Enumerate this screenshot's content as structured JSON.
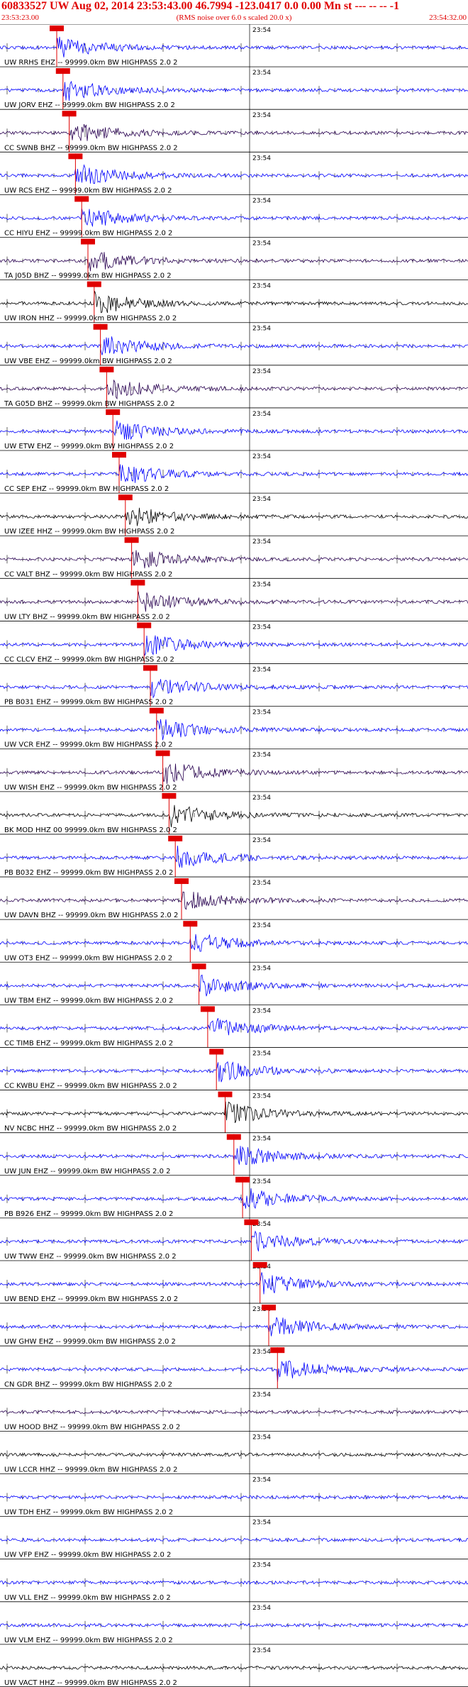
{
  "header": {
    "title": "60833527 UW Aug 02, 2014 23:53:43.00   46.7994 -123.0417   0.0 0.00 Mn st --- -- --   -1",
    "start_time": "23:53:23.00",
    "note": "(RMS noise over 6.0 s scaled 20.0 x)",
    "end_time": "23:54:32.00"
  },
  "colors": {
    "header_text": "#e00000",
    "pick": "#e00000",
    "trace_blue": "#0000ff",
    "trace_dark": "#280050",
    "trace_black": "#000000"
  },
  "chart_data": {
    "type": "line",
    "title": "60833527 UW Aug 02, 2014 23:53:43.00   46.7994 -123.0417   0.0 0.00 Mn st --- -- --   -1",
    "x_axis": {
      "start": "23:53:23.00",
      "end": "23:54:32.00",
      "minute_label": "23:54",
      "grid": true
    },
    "traces": [
      {
        "label": "UW RRHS EHZ -- 99999.0km BW  HIGHPASS  2.0  2",
        "pick": true,
        "color": "blue"
      },
      {
        "label": "UW JORV EHZ -- 99999.0km BW  HIGHPASS  2.0  2",
        "pick": true,
        "color": "blue"
      },
      {
        "label": "CC SWNB BHZ -- 99999.0km BW  HIGHPASS  2.0  2",
        "pick": true,
        "color": "dark"
      },
      {
        "label": "UW RCS EHZ -- 99999.0km BW  HIGHPASS  2.0  2",
        "pick": true,
        "color": "blue"
      },
      {
        "label": "CC HIYU EHZ -- 99999.0km BW  HIGHPASS  2.0  2",
        "pick": true,
        "color": "blue"
      },
      {
        "label": "TA J05D BHZ -- 99999.0km BW  HIGHPASS  2.0  2",
        "pick": true,
        "color": "dark"
      },
      {
        "label": "UW IRON HHZ -- 99999.0km BW  HIGHPASS  2.0  2",
        "pick": true,
        "color": "black"
      },
      {
        "label": "UW VBE EHZ -- 99999.0km BW  HIGHPASS  2.0  2",
        "pick": true,
        "color": "blue"
      },
      {
        "label": "TA G05D BHZ -- 99999.0km BW  HIGHPASS  2.0  2",
        "pick": true,
        "color": "dark"
      },
      {
        "label": "UW ETW EHZ -- 99999.0km BW  HIGHPASS  2.0  2",
        "pick": true,
        "color": "blue"
      },
      {
        "label": "CC SEP EHZ -- 99999.0km BW  HIGHPASS  2.0  2",
        "pick": true,
        "color": "blue"
      },
      {
        "label": "UW IZEE HHZ -- 99999.0km BW  HIGHPASS  2.0  2",
        "pick": true,
        "color": "black"
      },
      {
        "label": "CC VALT BHZ -- 99999.0km BW  HIGHPASS  2.0  2",
        "pick": true,
        "color": "dark"
      },
      {
        "label": "UW LTY BHZ -- 99999.0km BW  HIGHPASS  2.0  2",
        "pick": true,
        "color": "dark"
      },
      {
        "label": "CC CLCV EHZ -- 99999.0km BW  HIGHPASS  2.0  2",
        "pick": true,
        "color": "blue"
      },
      {
        "label": "PB B031 EHZ -- 99999.0km BW  HIGHPASS  2.0  2",
        "pick": true,
        "color": "blue"
      },
      {
        "label": "UW VCR EHZ -- 99999.0km BW  HIGHPASS  2.0  2",
        "pick": true,
        "color": "blue"
      },
      {
        "label": "UW WISH EHZ -- 99999.0km BW  HIGHPASS  2.0  2",
        "pick": true,
        "color": "dark"
      },
      {
        "label": "BK MOD HHZ 00 99999.0km BW  HIGHPASS  2.0  2",
        "pick": true,
        "color": "black"
      },
      {
        "label": "PB B032 EHZ -- 99999.0km BW  HIGHPASS  2.0  2",
        "pick": true,
        "color": "blue"
      },
      {
        "label": "UW DAVN BHZ -- 99999.0km BW  HIGHPASS  2.0  2",
        "pick": true,
        "color": "dark"
      },
      {
        "label": "UW OT3 EHZ -- 99999.0km BW  HIGHPASS  2.0  2",
        "pick": true,
        "color": "blue"
      },
      {
        "label": "UW TBM EHZ -- 99999.0km BW  HIGHPASS  2.0  2",
        "pick": true,
        "color": "blue"
      },
      {
        "label": "CC TIMB EHZ -- 99999.0km BW  HIGHPASS  2.0  2",
        "pick": true,
        "color": "blue"
      },
      {
        "label": "CC KWBU EHZ -- 99999.0km BW  HIGHPASS  2.0  2",
        "pick": true,
        "color": "blue"
      },
      {
        "label": "NV NCBC HHZ -- 99999.0km BW  HIGHPASS  2.0  2",
        "pick": true,
        "color": "black"
      },
      {
        "label": "UW JUN EHZ -- 99999.0km BW  HIGHPASS  2.0  2",
        "pick": true,
        "color": "blue"
      },
      {
        "label": "PB B926 EHZ -- 99999.0km BW  HIGHPASS  2.0  2",
        "pick": true,
        "color": "blue"
      },
      {
        "label": "UW TWW EHZ -- 99999.0km BW  HIGHPASS  2.0  2",
        "pick": true,
        "color": "blue"
      },
      {
        "label": "UW BEND EHZ -- 99999.0km BW  HIGHPASS  2.0  2",
        "pick": true,
        "color": "blue"
      },
      {
        "label": "UW GHW EHZ -- 99999.0km BW  HIGHPASS  2.0  2",
        "pick": true,
        "color": "blue"
      },
      {
        "label": "CN GDR BHZ -- 99999.0km BW  HIGHPASS  2.0  2",
        "pick": true,
        "color": "blue"
      },
      {
        "label": "UW HOOD BHZ -- 99999.0km BW  HIGHPASS  2.0  2",
        "pick": false,
        "color": "dark"
      },
      {
        "label": "UW LCCR HHZ -- 99999.0km BW  HIGHPASS  2.0  2",
        "pick": false,
        "color": "black"
      },
      {
        "label": "UW TDH EHZ -- 99999.0km BW  HIGHPASS  2.0  2",
        "pick": false,
        "color": "blue"
      },
      {
        "label": "UW VFP EHZ -- 99999.0km BW  HIGHPASS  2.0  2",
        "pick": false,
        "color": "blue"
      },
      {
        "label": "UW VLL EHZ -- 99999.0km BW  HIGHPASS  2.0  2",
        "pick": false,
        "color": "blue"
      },
      {
        "label": "UW VLM EHZ -- 99999.0km BW  HIGHPASS  2.0  2",
        "pick": false,
        "color": "blue"
      },
      {
        "label": "UW VACT HHZ -- 99999.0km BW  HIGHPASS  2.0  2",
        "pick": false,
        "color": "black"
      }
    ]
  }
}
